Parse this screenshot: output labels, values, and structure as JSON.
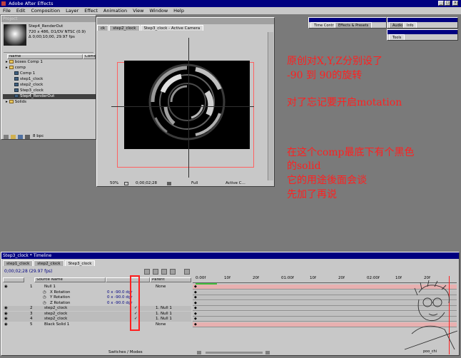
{
  "app": {
    "title": "Adobe After Effects",
    "menu": [
      "File",
      "Edit",
      "Composition",
      "Layer",
      "Effect",
      "Animation",
      "View",
      "Window",
      "Help"
    ]
  },
  "project": {
    "item_name": "Step4_RenderOut",
    "info_line1": "720 x 486, D1/DV NTSC (0.9)",
    "info_line2": "Δ 0;00;10;00, 29.97 fps",
    "col_name": "Name",
    "col_comment": "Comme",
    "items": [
      {
        "label": "boxes Comp 1",
        "type": "folder",
        "indent": 0
      },
      {
        "label": "comp",
        "type": "folder",
        "indent": 0
      },
      {
        "label": "Comp 1",
        "type": "comp",
        "indent": 1
      },
      {
        "label": "step1_clock",
        "type": "comp",
        "indent": 1
      },
      {
        "label": "step2_clock",
        "type": "comp",
        "indent": 1
      },
      {
        "label": "Step3_clock",
        "type": "comp",
        "indent": 1
      },
      {
        "label": "Step4_RenderOut",
        "type": "comp",
        "indent": 1
      },
      {
        "label": "Solids",
        "type": "folder",
        "indent": 0
      }
    ],
    "bpc_label": "8 bpc"
  },
  "comp_window": {
    "tabs": [
      "ck",
      "step2_clock",
      "Step3_clock - Active Camera"
    ],
    "zoom": "50%",
    "timecode": "0;00;02;28",
    "resolution": "Full",
    "camera": "Active C..."
  },
  "palettes": {
    "time_controls": "Time Contr",
    "effects": "Effects & Presets",
    "audio": "Audio",
    "info": "Info",
    "tools": "Tools"
  },
  "annotations": {
    "line1": "原创对X,Y,Z分别设了",
    "line2": "-90 到 90的旋转",
    "line3": "对了忘记要开启motation",
    "line4": "在这个comp最底下有个黑色",
    "line5": "的solid",
    "line6": "它的用途後面会谈",
    "line7": "先加了再说"
  },
  "timeline": {
    "title": "Step3_clock * Timeline",
    "tabs": [
      "step1_clock",
      "step2_clock",
      "Step3_clock"
    ],
    "timecode": "0;00;02;28 (29.97 fps)",
    "col_source": "Source Name",
    "col_parent": "Parent",
    "ticks": [
      "0:00f",
      "10f",
      "20f",
      "01:00f",
      "10f",
      "20f",
      "02:00f",
      "10f",
      "20f"
    ],
    "layers": [
      {
        "num": "1",
        "name": "Null 1",
        "parent": "None",
        "props": [
          {
            "name": "X Rotation",
            "value": "0 x -90.0 dgr"
          },
          {
            "name": "Y Rotation",
            "value": "0 x -90.0 dgr"
          },
          {
            "name": "Z Rotation",
            "value": "0 x -90.0 dgr"
          }
        ]
      },
      {
        "num": "2",
        "name": "step2_clock",
        "parent": "1. Null 1"
      },
      {
        "num": "3",
        "name": "step2_clock",
        "parent": "1. Null 1"
      },
      {
        "num": "4",
        "name": "step2_clock",
        "parent": "1. Null 1"
      },
      {
        "num": "5",
        "name": "Black Solid 1",
        "parent": "None"
      }
    ],
    "footer": "Switches / Modes",
    "signature": "poo_chi"
  }
}
